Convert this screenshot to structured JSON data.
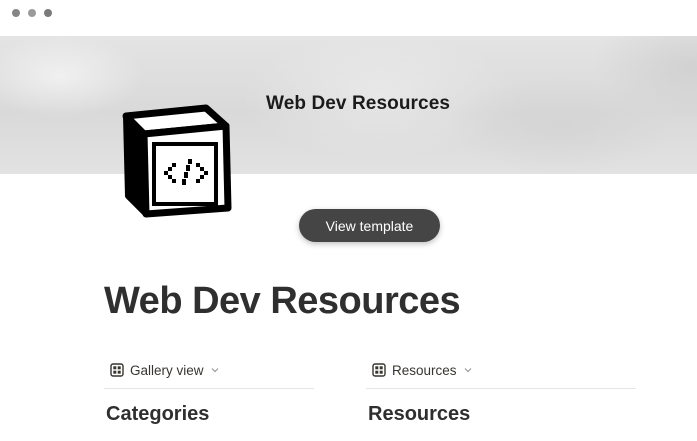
{
  "cover": {
    "title": "Web Dev Resources"
  },
  "page": {
    "icon_name": "code-cube-icon",
    "title": "Web Dev Resources"
  },
  "actions": {
    "view_template_label": "View template"
  },
  "views": [
    {
      "label": "Gallery view",
      "icon_name": "gallery-grid-icon",
      "heading": "Categories"
    },
    {
      "label": "Resources",
      "icon_name": "table-grid-icon",
      "heading": "Resources"
    }
  ]
}
